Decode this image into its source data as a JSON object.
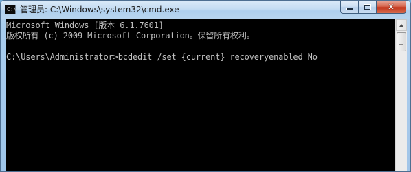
{
  "window": {
    "title": "管理员: C:\\Windows\\system32\\cmd.exe",
    "icon": "cmd-console-icon",
    "icon_glyph": "C:\\"
  },
  "caption_buttons": {
    "minimize_icon": "minimize-icon",
    "maximize_icon": "maximize-icon",
    "close_icon": "close-icon",
    "close_glyph": "✕"
  },
  "console": {
    "lines": [
      "Microsoft Windows [版本 6.1.7601]",
      "版权所有 (c) 2009 Microsoft Corporation。保留所有权利。",
      "C:\\Users\\Administrator>bcdedit /set {current} recoveryenabled No"
    ],
    "background_color": "#000000",
    "text_color": "#c0c0c0"
  },
  "scrollbar": {
    "up_arrow_icon": "scroll-up-arrow-icon"
  },
  "colors": {
    "titlebar": "#b8d5ef",
    "close_button": "#c3361c"
  }
}
